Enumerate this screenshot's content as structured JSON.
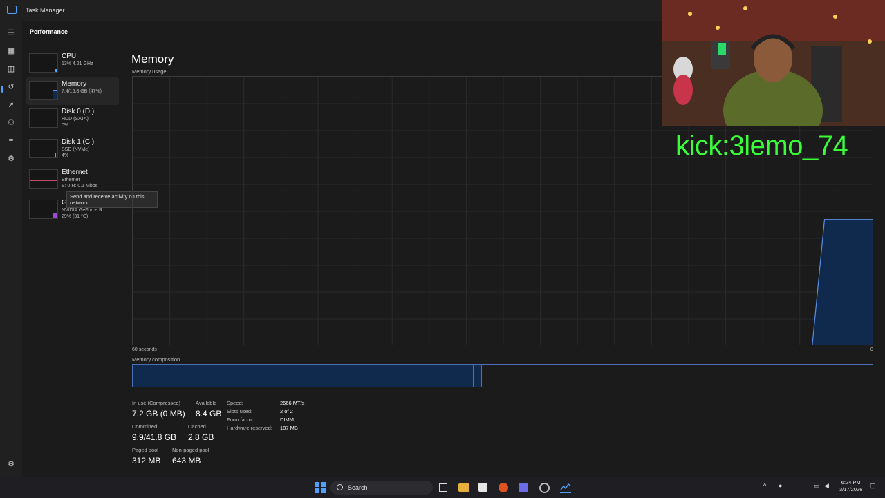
{
  "window": {
    "title": "Task Manager"
  },
  "page": {
    "header": "Performance"
  },
  "sidebar": {
    "items": [
      {
        "name": "CPU",
        "sub1": "13% 4.21 GHz",
        "sub2": "",
        "sub3": ""
      },
      {
        "name": "Memory",
        "sub1": "7.4/15.8 GB (47%)",
        "sub2": "",
        "sub3": ""
      },
      {
        "name": "Disk 0 (D:)",
        "sub1": "HDD (SATA)",
        "sub2": "0%",
        "sub3": ""
      },
      {
        "name": "Disk 1 (C:)",
        "sub1": "SSD (NVMe)",
        "sub2": "4%",
        "sub3": ""
      },
      {
        "name": "Ethernet",
        "sub1": "Ethernet",
        "sub2": "S: 0 R: 0.1 Mbps",
        "sub3": ""
      },
      {
        "name": "GPU 0",
        "sub1": "NVIDIA GeForce R...",
        "sub2": "29% (31 °C)",
        "sub3": ""
      }
    ]
  },
  "tooltip": {
    "text": "Send and receive activity on this network"
  },
  "main": {
    "title": "Memory",
    "usage_label": "Memory usage",
    "graph_left_label": "60 seconds",
    "graph_right_label": "0",
    "composition_label": "Memory composition"
  },
  "stats": {
    "in_use_label": "In use (Compressed)",
    "in_use_value": "7.2 GB (0 MB)",
    "available_label": "Available",
    "available_value": "8.4 GB",
    "committed_label": "Committed",
    "committed_value": "9.9/41.8 GB",
    "cached_label": "Cached",
    "cached_value": "2.8 GB",
    "paged_label": "Paged pool",
    "paged_value": "312 MB",
    "nonpaged_label": "Non-paged pool",
    "nonpaged_value": "643 MB"
  },
  "details": [
    {
      "key": "Speed:",
      "value": "2666 MT/s"
    },
    {
      "key": "Slots used:",
      "value": "2 of 2"
    },
    {
      "key": "Form factor:",
      "value": "DIMM"
    },
    {
      "key": "Hardware reserved:",
      "value": "187 MB"
    }
  ],
  "overlay": {
    "text": "kick:3lemo_74"
  },
  "taskbar": {
    "search_placeholder": "Search",
    "time": "6:24 PM",
    "date": "3/17/2026"
  },
  "memory_usage_series": {
    "x_label": "60 seconds",
    "note_values_percent": [
      0,
      0,
      0,
      0,
      0,
      0,
      0,
      0,
      0,
      0,
      0,
      0,
      0,
      0,
      0,
      0,
      0,
      0,
      0,
      0,
      0,
      0,
      0,
      0,
      0,
      0,
      0,
      0,
      0,
      0,
      0,
      0,
      0,
      0,
      0,
      0,
      0,
      0,
      0,
      0,
      0,
      0,
      0,
      0,
      0,
      0,
      0,
      0,
      0,
      0,
      0,
      0,
      0,
      0,
      0,
      0,
      47,
      47,
      47,
      47,
      47
    ]
  },
  "colors": {
    "accent": "#4ea1ff",
    "memory_fill": "#0f2a4d",
    "memory_line": "#5a8ee6",
    "overlay": "#39ff39"
  }
}
